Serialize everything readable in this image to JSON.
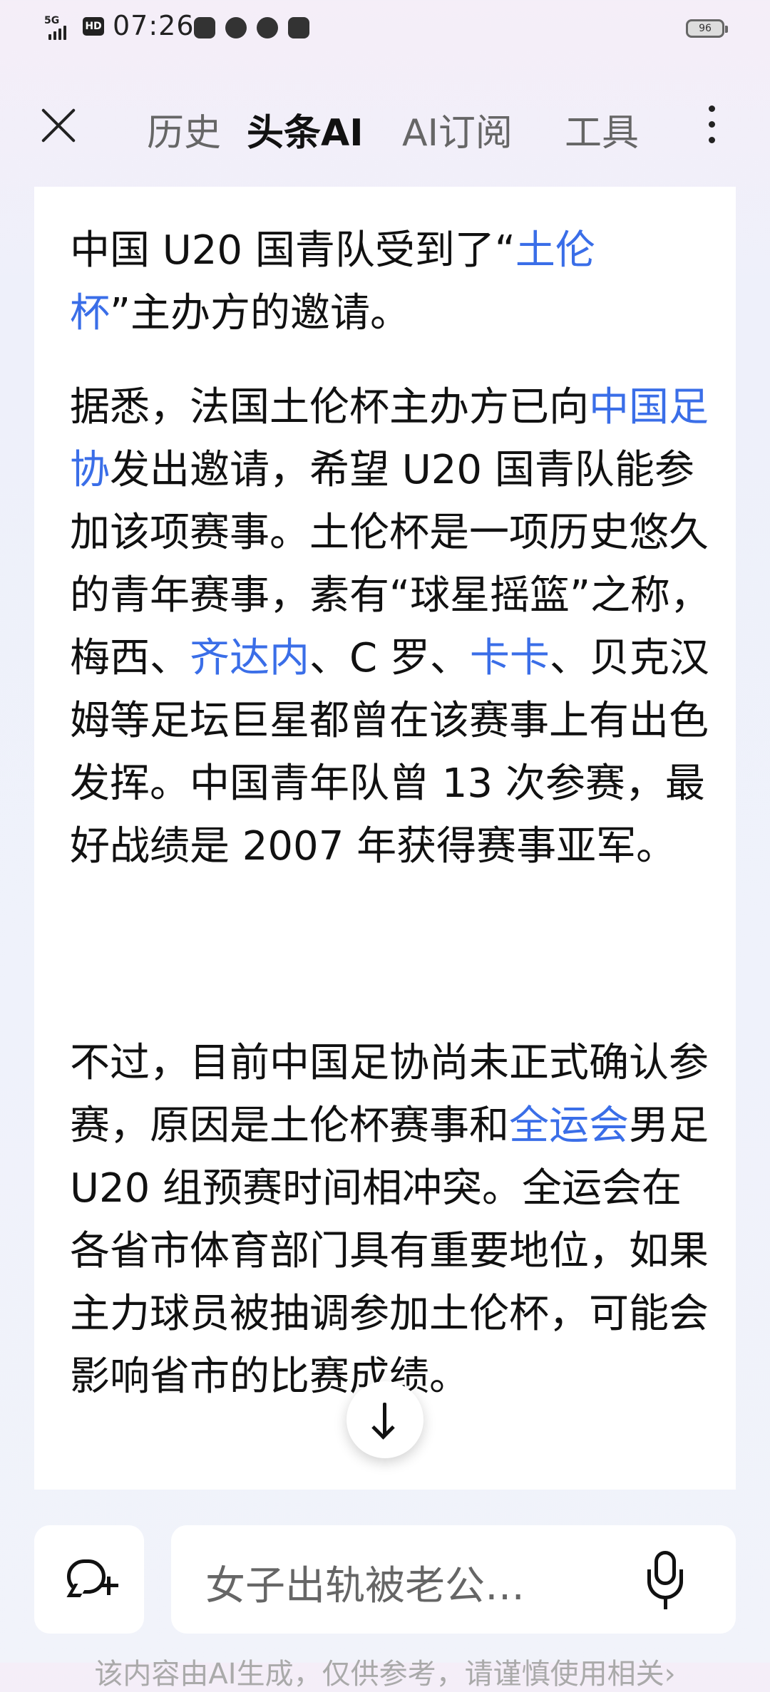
{
  "status_bar": {
    "network": "5G",
    "hd_label": "HD",
    "time": "07:26",
    "battery": "96"
  },
  "nav": {
    "tabs": [
      {
        "label": "历史"
      },
      {
        "label": "头条AI"
      },
      {
        "label": "AI订阅"
      },
      {
        "label": "工具"
      }
    ]
  },
  "article": {
    "p1": {
      "t1": "中国 U20 国青队受到了“",
      "link1": "土伦",
      "t2": "",
      "line2_link": "杯",
      "t3": "”主办方的邀请。"
    },
    "p2": {
      "t1": "据悉，法国土伦杯主办方已向",
      "link1": "中国足协",
      "t2": "发出邀请，希望 U20 国青队能参加该项赛事。土伦杯是一项历史悠久的青年赛事，素有“球星摇篮”之称，梅西、",
      "link2": "齐达内",
      "t3": "、C 罗、",
      "link3": "卡卡",
      "t4": "、贝克汉姆等足坛巨星都曾在该赛事上有出色发挥。中国青年队曾 13 次参赛，最好战绩是 2007 年获得赛事亚军。"
    },
    "p3": {
      "t1": "不过，目前中国足协尚未正式确认参赛，原因是土伦杯赛事和",
      "link1": "全运会",
      "t2": "男足 U20 组预赛时间相冲突。全运会在各省市体育部门具有重要地位，如果主力球员被抽调参加土伦杯，可能会影响省市的比赛成绩。"
    }
  },
  "input": {
    "placeholder": "女子出轨被老公…"
  },
  "disclaimer": "该内容由AI生成，仅供参考，请谨慎使用相关›",
  "colors": {
    "link": "#3a6ee8",
    "background": "#eff2fb"
  },
  "icons": [
    "close-icon",
    "more-icon",
    "arrow-down-icon",
    "new-chat-icon",
    "mic-icon"
  ]
}
